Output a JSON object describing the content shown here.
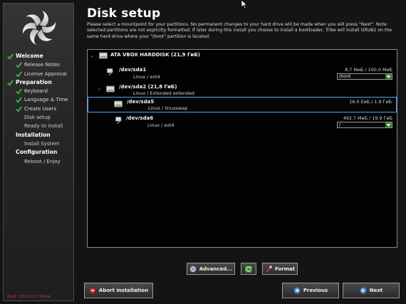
{
  "sidebar": {
    "steps": [
      {
        "label": "Welcome",
        "kind": "section",
        "checked": true
      },
      {
        "label": "Release Notes",
        "kind": "sub",
        "checked": true
      },
      {
        "label": "License Approval",
        "kind": "sub",
        "checked": true
      },
      {
        "label": "Preparation",
        "kind": "section",
        "checked": true
      },
      {
        "label": "Keyboard",
        "kind": "sub",
        "checked": true
      },
      {
        "label": "Language & Time",
        "kind": "sub",
        "checked": true
      },
      {
        "label": "Create Users",
        "kind": "sub",
        "checked": true
      },
      {
        "label": "Disk setup",
        "kind": "sub",
        "checked": false
      },
      {
        "label": "Ready to install",
        "kind": "sub",
        "checked": false
      },
      {
        "label": "Installation",
        "kind": "section",
        "checked": false
      },
      {
        "label": "Install System",
        "kind": "sub",
        "checked": false
      },
      {
        "label": "Configuration",
        "kind": "section",
        "checked": false
      },
      {
        "label": "Reboot / Enjoy",
        "kind": "sub",
        "checked": false
      }
    ],
    "build": "Build: 2013.02.07 (Beta)"
  },
  "header": {
    "title": "Disk setup",
    "description": "Please select a mountpoint for your partitions. No permanent changes to your hard drive will be made when you will press \"Next\". Note: selected partitions are not explicitly formatted. If later during this install you choose to install a bootloader, Tribe will install GRUB2 on the same hard drive where your \"/boot\" partition is located."
  },
  "disk": {
    "name": "ATA VBOX HARDDISK  (21,9 ГиБ)"
  },
  "partitions": {
    "sda1": {
      "name": "/dev/sda1",
      "type": "Linux / ext4",
      "size": "8.7 МиБ / 100.0 МиБ",
      "mount": "/boot"
    },
    "sda2": {
      "name": "/dev/sda2  (21,8 ГиБ)",
      "type": "Linux / Extended extended"
    },
    "sda5": {
      "name": "/dev/sda5",
      "type": "Linux / linuxswap",
      "size": "16.0 ЕиБ / 1.9 ГиБ"
    },
    "sda6": {
      "name": "/dev/sda6",
      "type": "Linux / ext4",
      "size": "492.7 МиБ / 19.9 ГиБ",
      "mount": "/"
    }
  },
  "buttons": {
    "advanced": "Advanced...",
    "format": "Format",
    "abort": "Abort installation",
    "previous": "Previous",
    "next": "Next"
  },
  "colors": {
    "check": "#3fae3f",
    "selection": "#4da2f0",
    "build_text": "#c23a3a"
  },
  "icons": {
    "logo": "tribe-logo-icon",
    "check": "check-icon",
    "disk": "hard-disk-icon",
    "partition": "partition-icon",
    "edit": "partition-edit-icon",
    "advanced": "advanced-settings-icon",
    "refresh": "refresh-icon",
    "format": "format-brush-icon",
    "abort": "stop-icon",
    "previous": "previous-arrow-icon",
    "next": "next-arrow-icon"
  }
}
